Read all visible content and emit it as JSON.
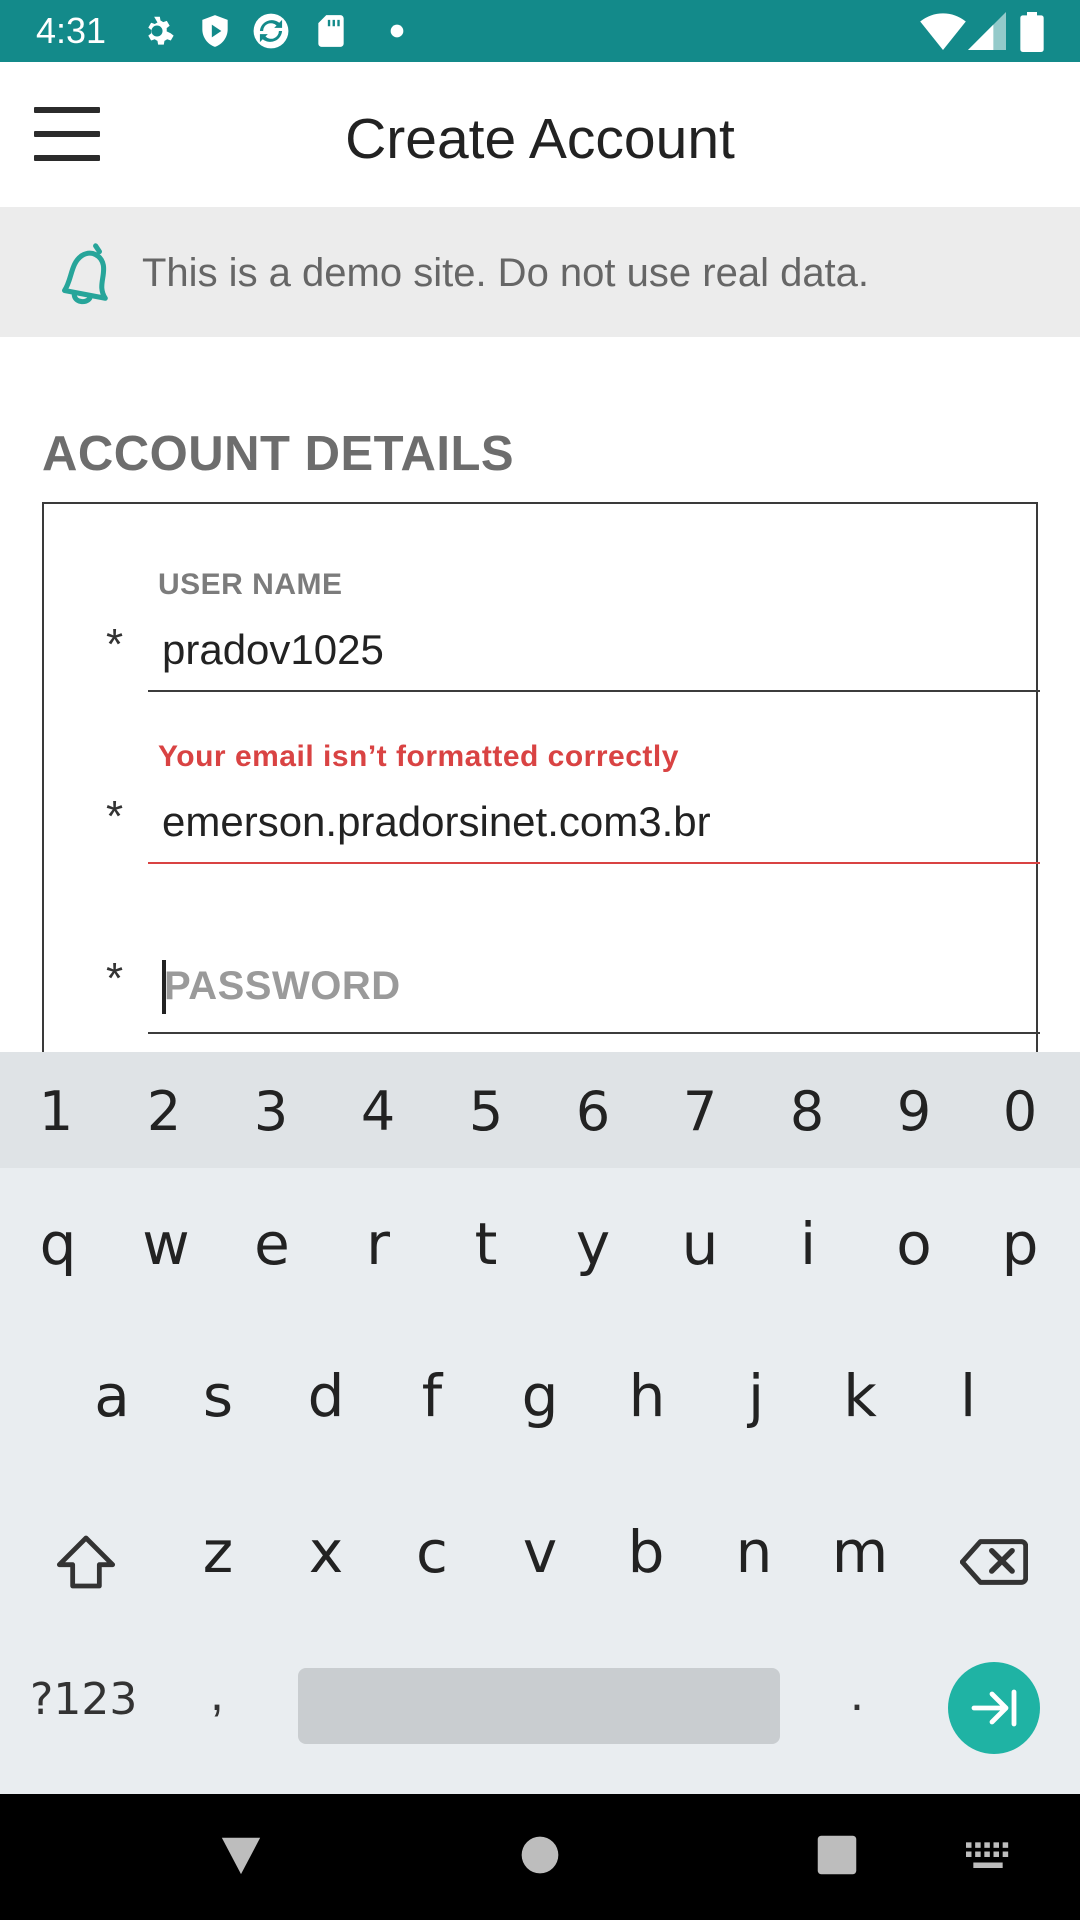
{
  "status_bar": {
    "time": "4:31",
    "left_icons": [
      "settings-icon",
      "shield-icon",
      "sync-icon",
      "sd-card-icon",
      "dot-icon"
    ],
    "right_icons": [
      "wifi-icon",
      "cell-signal-icon",
      "battery-icon"
    ],
    "background": "#138a8a"
  },
  "app_bar": {
    "title": "Create Account",
    "menu_icon": "hamburger-menu-icon"
  },
  "banner": {
    "icon": "bell-icon",
    "text": "This is a demo site. Do not use real data."
  },
  "section": {
    "title": "ACCOUNT DETAILS"
  },
  "form": {
    "username": {
      "label": "USER NAME",
      "value": "pradov1025",
      "required_mark": "*"
    },
    "email": {
      "error": "Your email isn’t formatted correctly",
      "value": "emerson.pradorsinet.com3.br",
      "required_mark": "*"
    },
    "password": {
      "placeholder": "PASSWORD",
      "required_mark": "*"
    }
  },
  "keyboard": {
    "number_row": [
      "1",
      "2",
      "3",
      "4",
      "5",
      "6",
      "7",
      "8",
      "9",
      "0"
    ],
    "row1": [
      "q",
      "w",
      "e",
      "r",
      "t",
      "y",
      "u",
      "i",
      "o",
      "p"
    ],
    "row2": [
      "a",
      "s",
      "d",
      "f",
      "g",
      "h",
      "j",
      "k",
      "l"
    ],
    "row3": [
      "z",
      "x",
      "c",
      "v",
      "b",
      "n",
      "m"
    ],
    "symbols_key": "?123",
    "comma_key": ",",
    "period_key": ".",
    "enter_icon": "next-field-icon"
  },
  "nav_bar": {
    "icons": [
      "back-icon",
      "home-icon",
      "recents-icon",
      "keyboard-icon"
    ]
  },
  "colors": {
    "accent": "#1fb3a4",
    "error": "#d94343"
  }
}
